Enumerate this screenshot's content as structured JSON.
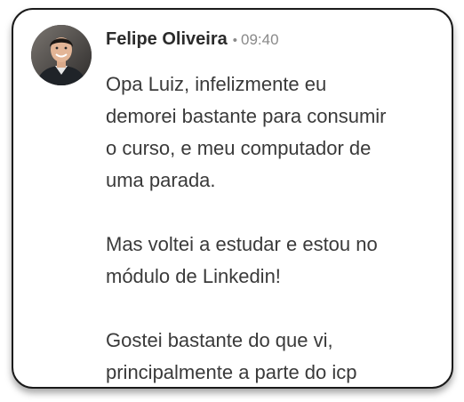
{
  "comment": {
    "author": "Felipe Oliveira",
    "separator": "•",
    "time": "09:40",
    "avatar_icon": "user-avatar-photo",
    "paragraphs": [
      [
        "Opa Luiz, infelizmente eu",
        "demorei bastante para consumir",
        "o curso, e meu computador de",
        "uma parada."
      ],
      [
        "Mas voltei a estudar e estou no",
        "módulo de Linkedin!"
      ],
      [
        "Gostei bastante do que vi,",
        "principalmente a parte do icp"
      ]
    ]
  }
}
